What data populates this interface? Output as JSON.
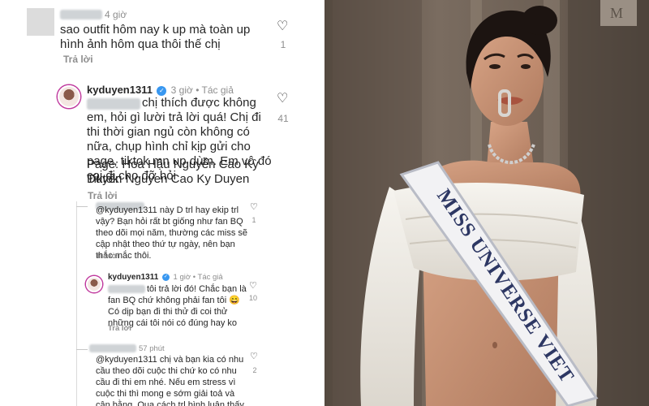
{
  "comments": {
    "c1": {
      "time": "4 giờ",
      "text": "sao outfit hôm nay k up mà toàn up hình ảnh hôm qua thôi thế chị",
      "reply_label": "Trả lời",
      "like_count": "1"
    },
    "c2": {
      "username": "kyduyen1311",
      "time": "3 giờ",
      "author_tag": "Tác giả",
      "text": "chị thích được không em, hỏi gì lười trả lời quá! Chị đi thi thời gian ngủ còn không có nữa, chụp hình chỉ kịp gửi cho page, tiktok mn up dùm. Em vô đó coi đi cho đỡ hỏi",
      "page_line": "Page: Hoa Hậu Nguyễn Cao Kỳ Duyên",
      "tiktok_line": "Tiktok: Nguyen Cao Ky Duyen",
      "reply_label": "Trả lời",
      "like_count": "41"
    },
    "c3": {
      "text": "@kyduyen1311 này D trl hay ekip trl vậy? Bạn hỏi rất bt giống như fan BQ theo dõi mọi năm, thường các miss sẽ cập nhật theo thứ tự ngày, nên bạn thắc mắc thôi.",
      "reply_label": "Trả lời",
      "like_count": "1"
    },
    "c4": {
      "username": "kyduyen1311",
      "time": "1 giờ",
      "author_tag": "Tác giả",
      "text": "tôi trả lời đó! Chắc bạn là fan BQ chứ không phải fan tôi 😄 Có dịp bạn đi thi thử đi coi thử những cái tôi nói có đúng hay ko",
      "reply_label": "Trả lời",
      "like_count": "10"
    },
    "c5": {
      "time": "57 phút",
      "text": "@kyduyen1311 chị và bạn kia có nhu cầu theo dõi cuộc thi chứ ko có nhu cầu đi thi em nhé. Nếu em stress vì cuộc thi thì mong e sớm giải toả và cân bằng. Qua cách trl bình luận thấy hiện em hiện ko đc thoải mái về tâm lý",
      "like_count": "2"
    }
  },
  "photo": {
    "sash_text": "MISS UNIVERSE VIET",
    "colors": {
      "wall": "#6f6258",
      "sash": "#f2f2f4",
      "sash_text": "#2d3763",
      "top": "#efece6",
      "skin": "#c48f73",
      "hair": "#1c1411"
    }
  },
  "icons": {
    "like": "heart-icon",
    "verified": "verified-badge-icon"
  }
}
